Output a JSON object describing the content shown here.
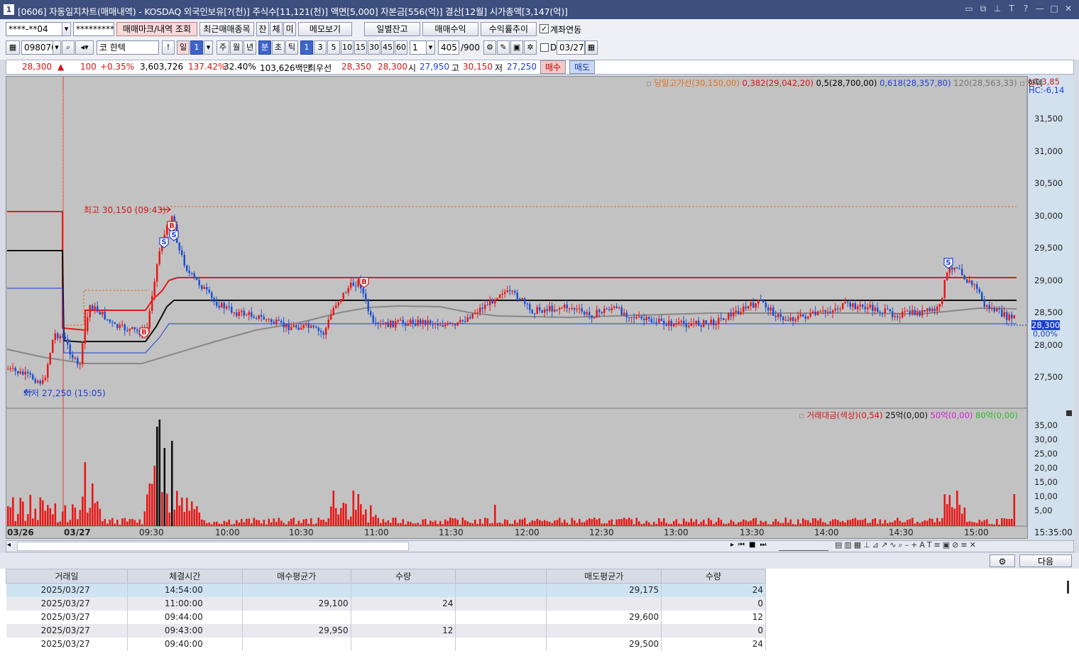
{
  "window": {
    "number": "1",
    "title": "[0606] 자동일지차트(매매내역) - KOSDAQ 외국인보유[?(천)] 주식수[11,121(천)] 액면[5,000] 자본금[556(억)] 결산[12월] 시가총액[3,147(억)]"
  },
  "toolbar1": {
    "account": "****-**04",
    "password": "*********",
    "mark_btn": "매매마크/내역 조회",
    "recent_btn": "최근매매종목",
    "tab_jan": "잔",
    "tab_che": "체",
    "tab_mi": "미",
    "memo_btn": "메모보기",
    "daily_btn": "일별잔고",
    "profit_btn": "매매수익",
    "return_btn": "수익률추이",
    "link_label": "계좌연동"
  },
  "toolbar2": {
    "code": "098070",
    "market": "코",
    "name": "한텍",
    "period": [
      "일",
      "1",
      "주",
      "월",
      "년",
      "분",
      "초",
      "틱"
    ],
    "intervals": [
      "1",
      "3",
      "5",
      "10",
      "15",
      "30",
      "45",
      "60"
    ],
    "count": "1",
    "bars": "405",
    "bars_max": "/900",
    "d_label": "D",
    "date": "03/27"
  },
  "pricebar": {
    "price": "28,300",
    "arrow": "▲",
    "change": "100",
    "pct": "+0.35%",
    "volume": "3,603,726",
    "vol_ratio": "137.42%",
    "turnover": "32.40%",
    "amount": "103,626백만",
    "best_label": "최우선",
    "best_ask": "28,350",
    "best_bid": "28,300",
    "open_label": "시",
    "open": "27,950",
    "high_label": "고",
    "high": "30,150",
    "low_label": "저",
    "low": "27,250",
    "buy": "매수",
    "sell": "매도"
  },
  "chart": {
    "legend_high": "당일고가선(30,150,00)",
    "fib382": "0,382(29,042,20)",
    "fib5": "0,5(28,700,00)",
    "fib618": "0,618(28,357,80)",
    "ma120": "120(28,563,33)",
    "stock": "한텍",
    "lc": "LC:3,85",
    "hc": "HC:-6,14",
    "high_mark": "최고 30,150 (09:43)",
    "low_mark": "최저 27,250 (15:05)",
    "current": "28,300",
    "current_pct": "0,00%",
    "y_ticks": [
      "31,500",
      "31,000",
      "30,500",
      "30,000",
      "29,500",
      "29,000",
      "28,500",
      "28,000",
      "27,500"
    ],
    "vol_legend": "거래대금(색상)(0,54)",
    "vol25": "25억(0,00)",
    "vol50": "50억(0,00)",
    "vol80": "80억(0,00)",
    "vol_ticks": [
      "35,00",
      "30,00",
      "25,00",
      "20,00",
      "15,00",
      "10,00",
      "5,00"
    ],
    "x_labels": [
      "03/26",
      "03/27",
      "09:30",
      "10:00",
      "10:30",
      "11:00",
      "11:30",
      "12:00",
      "12:30",
      "13:00",
      "13:30",
      "14:00",
      "14:30",
      "15:00",
      "15:35:00"
    ]
  },
  "chart_data": {
    "type": "candlestick",
    "title": "",
    "y_range": [
      27000,
      32000
    ],
    "high": 30150,
    "low": 27250,
    "open": 27950,
    "close": 28300
  },
  "grid": {
    "settings_btn": "",
    "next_btn": "다음",
    "headers": [
      "거래일",
      "체결시간",
      "매수평균가",
      "수량",
      "",
      "매도평균가",
      "수량"
    ],
    "rows": [
      [
        "2025/03/27",
        "14:54:00",
        "",
        "",
        "",
        "29,175",
        "24"
      ],
      [
        "2025/03/27",
        "11:00:00",
        "29,100",
        "24",
        "",
        "",
        "0"
      ],
      [
        "2025/03/27",
        "09:44:00",
        "",
        "",
        "",
        "29,600",
        "12"
      ],
      [
        "2025/03/27",
        "09:43:00",
        "29,950",
        "12",
        "",
        "",
        "0"
      ],
      [
        "2025/03/27",
        "09:40:00",
        "",
        "",
        "",
        "29,500",
        "24"
      ]
    ]
  }
}
